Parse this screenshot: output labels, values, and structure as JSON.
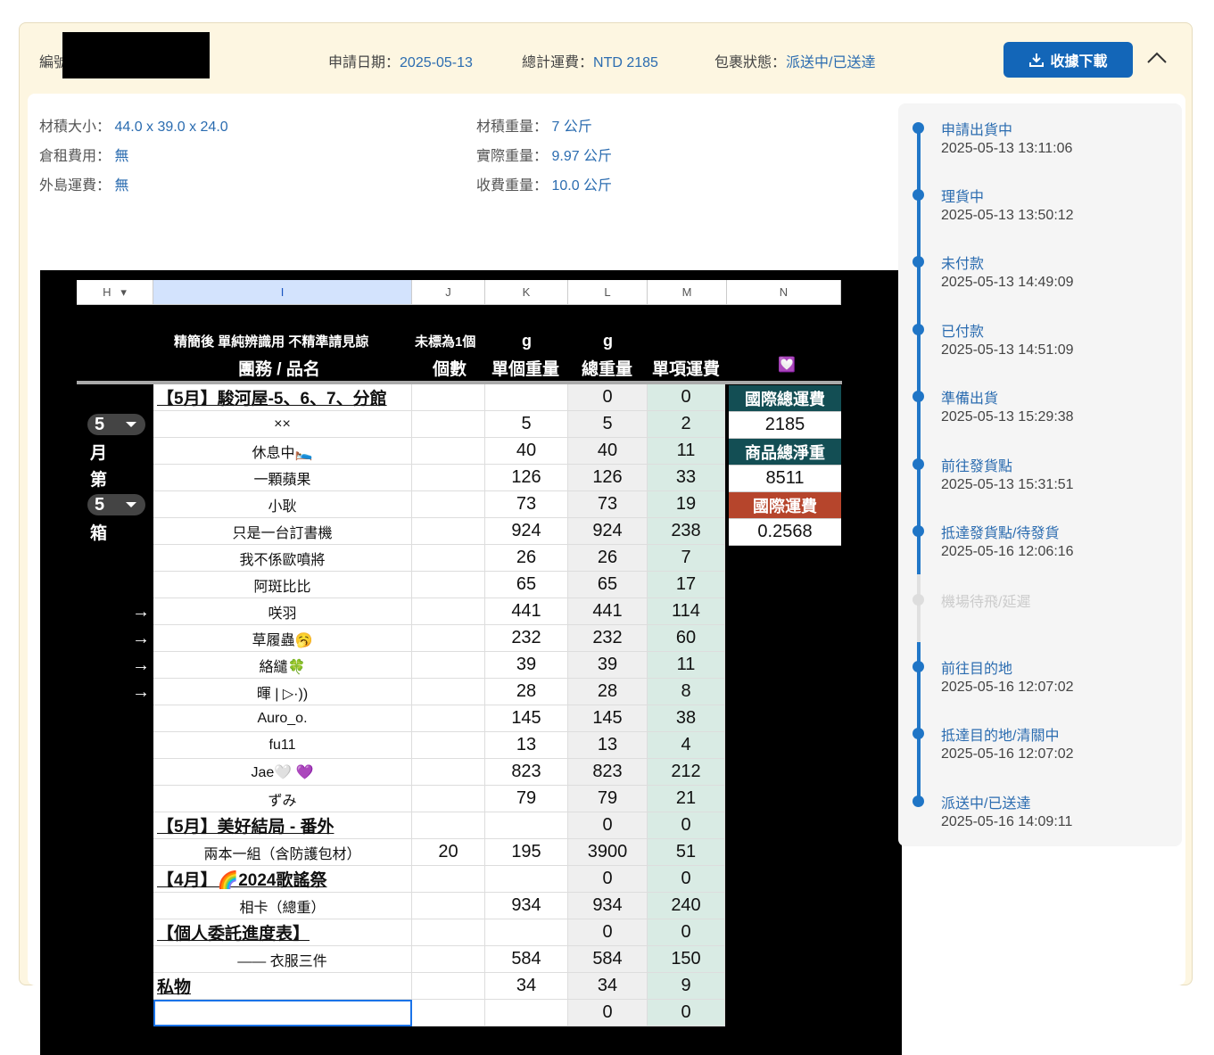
{
  "header": {
    "id_label": "編號",
    "apply_date_label": "申請日期：",
    "apply_date": "2025-05-13",
    "total_label": "總計運費：",
    "total": "NTD 2185",
    "status_label": "包裹狀態：",
    "status": "派送中/已送達",
    "download_label": "收據下載"
  },
  "info": {
    "volume_size_label": "材積大小：",
    "volume_size": "44.0 x 39.0 x 24.0",
    "storage_fee_label": "倉租費用：",
    "storage_fee": "無",
    "island_fee_label": "外島運費：",
    "island_fee": "無",
    "volume_weight_label": "材積重量：",
    "volume_weight": "7 公斤",
    "actual_weight_label": "實際重量：",
    "actual_weight": "9.97 公斤",
    "charge_weight_label": "收費重量：",
    "charge_weight": "10.0 公斤"
  },
  "sheet": {
    "col_headers": [
      "H",
      "I",
      "J",
      "K",
      "L",
      "M",
      "N"
    ],
    "note": "精簡後 單純辨識用 不精準請見諒",
    "name_header": "團務 / 品名",
    "unmarked_note": "未標為1個",
    "count_header": "個數",
    "unit_g": "g",
    "unit_weight_header": "單個重量",
    "total_g": "g",
    "total_weight_header": "總重量",
    "item_fee_header": "單項運費",
    "heart": "💟",
    "pill1": "5",
    "pill2": "5",
    "side_chars": [
      "月",
      "第",
      "箱"
    ],
    "arrow": "→",
    "rows": [
      {
        "name": "【5月】駿河屋-5、6、7、分館",
        "count": "",
        "unit": "",
        "total": "0",
        "fee": "0",
        "section": true
      },
      {
        "name": "××",
        "count": "",
        "unit": "5",
        "total": "5",
        "fee": "2",
        "section": false
      },
      {
        "name": "休息中🛌",
        "count": "",
        "unit": "40",
        "total": "40",
        "fee": "11",
        "section": false
      },
      {
        "name": "一顆蘋果",
        "count": "",
        "unit": "126",
        "total": "126",
        "fee": "33",
        "section": false
      },
      {
        "name": "小耿",
        "count": "",
        "unit": "73",
        "total": "73",
        "fee": "19",
        "section": false
      },
      {
        "name": "只是一台訂書機",
        "count": "",
        "unit": "924",
        "total": "924",
        "fee": "238",
        "section": false
      },
      {
        "name": "我不係歐噴將",
        "count": "",
        "unit": "26",
        "total": "26",
        "fee": "7",
        "section": false
      },
      {
        "name": "阿斑比比",
        "count": "",
        "unit": "65",
        "total": "65",
        "fee": "17",
        "section": false
      },
      {
        "name": "咲羽",
        "count": "",
        "unit": "441",
        "total": "441",
        "fee": "114",
        "section": false
      },
      {
        "name": "草履蟲🥱",
        "count": "",
        "unit": "232",
        "total": "232",
        "fee": "60",
        "section": false
      },
      {
        "name": "絡繾🍀",
        "count": "",
        "unit": "39",
        "total": "39",
        "fee": "11",
        "section": false
      },
      {
        "name": "暉 | ▷·))",
        "count": "",
        "unit": "28",
        "total": "28",
        "fee": "8",
        "section": false
      },
      {
        "name": "Auro_o.",
        "count": "",
        "unit": "145",
        "total": "145",
        "fee": "38",
        "section": false
      },
      {
        "name": "fu11",
        "count": "",
        "unit": "13",
        "total": "13",
        "fee": "4",
        "section": false
      },
      {
        "name": "Jae🤍 💜",
        "count": "",
        "unit": "823",
        "total": "823",
        "fee": "212",
        "section": false
      },
      {
        "name": "ずみ",
        "count": "",
        "unit": "79",
        "total": "79",
        "fee": "21",
        "section": false
      },
      {
        "name": "【5月】美好結局 - 番外",
        "count": "",
        "unit": "",
        "total": "0",
        "fee": "0",
        "section": true
      },
      {
        "name": "兩本一組（含防護包材）",
        "count": "20",
        "unit": "195",
        "total": "3900",
        "fee": "51",
        "section": false
      },
      {
        "name": "【4月】🌈2024歌謠祭",
        "count": "",
        "unit": "",
        "total": "0",
        "fee": "0",
        "section": true
      },
      {
        "name": "相卡（總重）",
        "count": "",
        "unit": "934",
        "total": "934",
        "fee": "240",
        "section": false
      },
      {
        "name": "【個人委託進度表】",
        "count": "",
        "unit": "",
        "total": "0",
        "fee": "0",
        "section": true
      },
      {
        "name": "—— 衣服三件",
        "count": "",
        "unit": "584",
        "total": "584",
        "fee": "150",
        "section": false
      },
      {
        "name": " 私物",
        "count": "",
        "unit": "34",
        "total": "34",
        "fee": "9",
        "section": true
      },
      {
        "name": "",
        "count": "",
        "unit": "",
        "total": "0",
        "fee": "0",
        "section": false
      }
    ],
    "summary": {
      "intl_total_label": "國際總運費",
      "intl_total": "2185",
      "net_weight_label": "商品總淨重",
      "net_weight": "8511",
      "intl_fee_label": "國際運費",
      "intl_fee": "0.2568"
    }
  },
  "timeline": [
    {
      "title": "申請出貨中",
      "time": "2025-05-13 13:11:06",
      "active": true
    },
    {
      "title": "理貨中",
      "time": "2025-05-13 13:50:12",
      "active": true
    },
    {
      "title": "未付款",
      "time": "2025-05-13 14:49:09",
      "active": true
    },
    {
      "title": "已付款",
      "time": "2025-05-13 14:51:09",
      "active": true
    },
    {
      "title": "準備出貨",
      "time": "2025-05-13 15:29:38",
      "active": true
    },
    {
      "title": "前往發貨點",
      "time": "2025-05-13 15:31:51",
      "active": true
    },
    {
      "title": "抵達發貨點/待發貨",
      "time": "2025-05-16 12:06:16",
      "active": true
    },
    {
      "title": "機場待飛/延遲",
      "time": "",
      "active": false
    },
    {
      "title": "前往目的地",
      "time": "2025-05-16 12:07:02",
      "active": true
    },
    {
      "title": "抵達目的地/清關中",
      "time": "2025-05-16 12:07:02",
      "active": true
    },
    {
      "title": "派送中/已送達",
      "time": "2025-05-16 14:09:11",
      "active": true
    }
  ]
}
